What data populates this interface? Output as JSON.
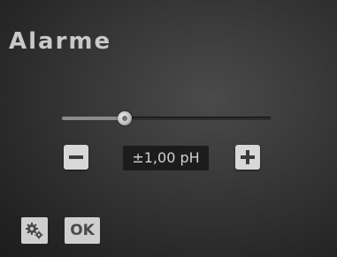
{
  "screen": {
    "title": "Alarme"
  },
  "slider": {
    "value_fraction": 0.3,
    "track_color": "#2e2e2e",
    "fill_color": "#8c8c8c"
  },
  "stepper": {
    "decrement_icon": "minus-icon",
    "increment_icon": "plus-icon",
    "value": "±1,00 pH"
  },
  "footer": {
    "settings_icon": "gears-icon",
    "ok_label": "OK"
  },
  "colors": {
    "background": "#2f2f2f",
    "button": "#d8d8d8",
    "text": "#c9c9c9"
  }
}
